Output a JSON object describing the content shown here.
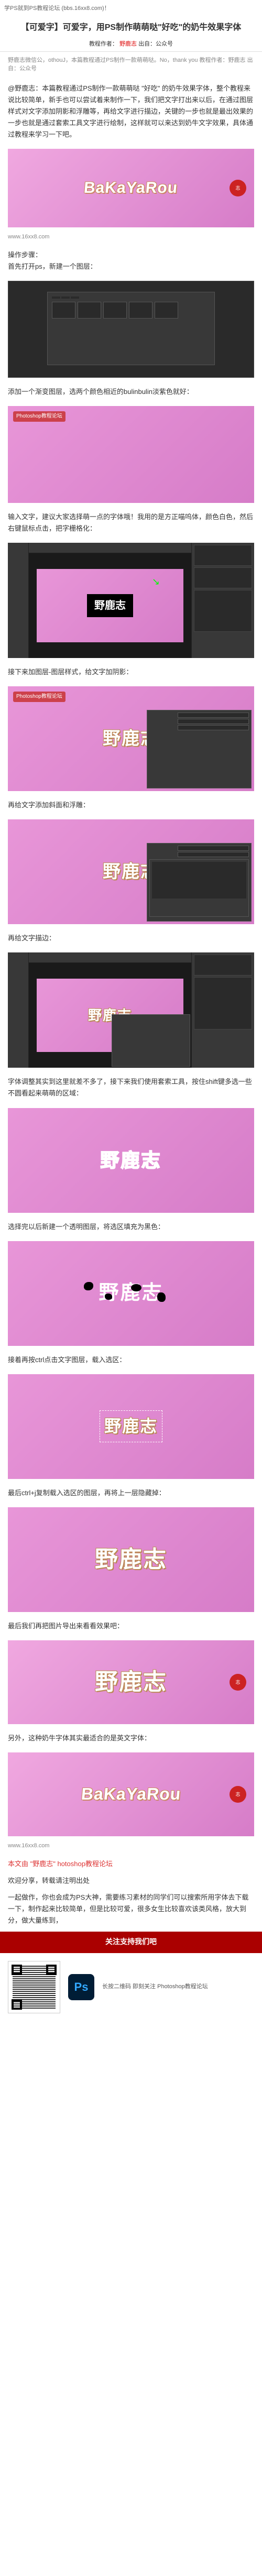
{
  "header": "学PS就到PS教程论坛 (bbs.16xx8.com)！",
  "title": "【可爱字】可爱字，用PS制作萌萌哒\"好吃\"的奶牛效果字体",
  "meta": {
    "label": "教程作者：",
    "author": "野鹿志",
    "source": "出自：公众号"
  },
  "intro_small": "野鹿志微信公，othouJ，本篇教程通过PS制作一款萌萌哒。No，thank you 教程作者：野鹿志 出自：公众号",
  "p1": "@野鹿志：本篇教程通过PS制作一款萌萌哒 \"好吃\" 的奶牛效果字体，整个教程来说比较简单，新手也可以尝试着来制作一下，我们把文字打出来以后，在通过图层样式对文字添加阴影和浮雕等，再给文字进行描边，关键的一步也就是最出效果的一步也就是通过套索工具文字进行绘制，这样就可以来达到奶牛文字效果，具体通过教程来学习一下吧。",
  "watermark": "www.16xx8.com",
  "hero_text": "BaKaYaRou",
  "step1": "操作步骤：\n首先打开ps，新建一个图层：",
  "step2": "添加一个渐变图层，选两个颜色相近的bulinbulin淡紫色就好：",
  "step3": "输入文字，建议大家选择萌一点的字体哦！我用的是方正喵呜体，颜色白色，然后右键鼠标点击，把字栅格化：",
  "text_sample": "野鹿志",
  "step4": "接下来加图层-图层样式，给文字加阴影：",
  "step5": "再给文字添加斜面和浮雕：",
  "step6": "再给文字描边：",
  "step7": "字体调整其实到这里就差不多了，接下来我们使用套索工具，按住shift键多选一些不圆看起来萌萌的区域：",
  "step8": "选择完以后新建一个透明图层，将选区填充为黑色：",
  "step9": "接着再按ctrl点击文字图层，载入选区：",
  "step10": "最后ctrl+j复制载入选区的图层，再将上一层隐藏掉：",
  "step11": "最后我们再把图片导出来看看效果吧：",
  "step12": "另外，这种奶牛字体其实最适合的是英文字体：",
  "footer_p1": "本文由 \"野鹿志\" hotoshop教程论坛",
  "footer_p2": "欢迎分享，转载请注明出处",
  "footer_p3": "一起做作，你也会成为PS大神，需要练习素材的同学们可以搜索所用字体去下载一下，制作起来比较简单，但是比较可爱，很多女生比较喜欢该类风格，放大到分，做大量练到，",
  "banner": "关注支持我们吧",
  "qr_label": "长按二维码 即刻关注 Photoshop教程论坛",
  "rouge": "志"
}
